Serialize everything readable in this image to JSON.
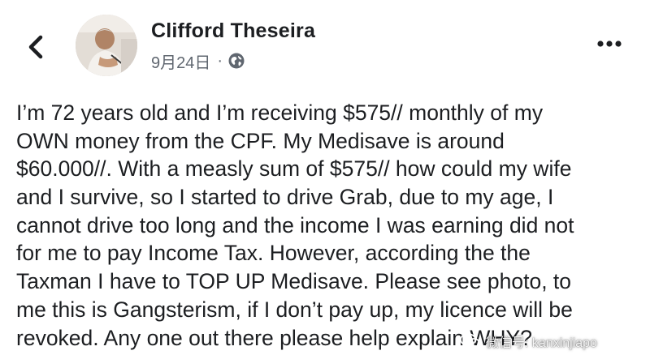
{
  "header": {
    "author_name": "Clifford Theseira",
    "timestamp": "9月24日",
    "separator": "·",
    "privacy_icon": "globe-icon",
    "back_icon": "chevron-left-icon",
    "more_icon": "more-horizontal-icon"
  },
  "post": {
    "lines": [
      "I’m 72 years old and I’m receiving $575// monthly of my",
      "OWN money from the CPF. My Medisave is around",
      "$60.000//. With a measly sum of $575// how could my wife",
      "and I survive, so I started to drive Grab, due to my age, I",
      "cannot drive too long and the income I was earning did not",
      "for me to pay Income Tax. However, according the the",
      "Taxman I have to TOP UP Medisave. Please see photo, to",
      "me this is Gangsterism, if I don’t pay up, my licence will be",
      "revoked. Any one out there please help explain WHY?"
    ]
  },
  "watermark": {
    "text": "微信号: kanxinjiapo",
    "icon": "wechat-icon"
  },
  "colors": {
    "text": "#1c1e21",
    "meta": "#606770",
    "background": "#ffffff"
  }
}
